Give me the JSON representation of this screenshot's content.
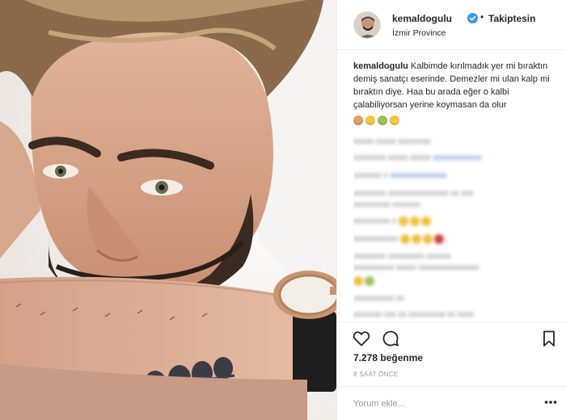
{
  "post": {
    "username": "kemaldogulu",
    "follow_status": "Takiptesin",
    "location": "İzmir Province",
    "caption_user": "kemaldogulu",
    "caption_text": "Kalbimde kırılmadık yer mi bıraktın demiş sanatçı eserinde. Demezler mi ulan kalp mi bıraktın diye. Haa bu arada eğer o kalbi çalabiliyorsan yerine koymasan da olur",
    "likes": "7.278 beğenme",
    "time": "8 SAAT ÖNCE"
  },
  "comment_bar": {
    "placeholder": "Yorum ekle..."
  },
  "icons": {
    "verified": "verified-badge-icon",
    "like": "heart-icon",
    "comment": "comment-icon",
    "save": "bookmark-icon",
    "more": "more-options-icon"
  },
  "colors": {
    "verified": "#3897f0",
    "text": "#262626",
    "muted": "#999999",
    "border": "#efefef"
  }
}
